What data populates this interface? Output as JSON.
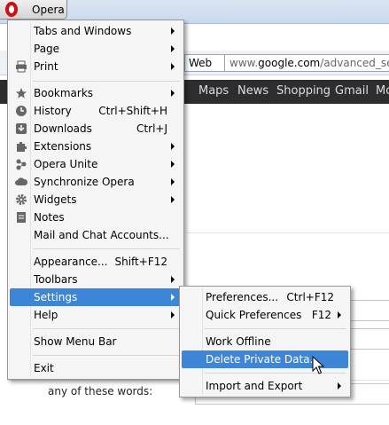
{
  "browser": {
    "opera_button_label": "Opera",
    "search_engine": "Web",
    "url_prefix": "www.",
    "url_domain": "google.com",
    "url_rest": "/advanced_searc",
    "google_nav": [
      "Maps",
      "News",
      "Shopping",
      "Gmail",
      "Mo"
    ],
    "form_label": "any of these words:"
  },
  "main_menu": {
    "items": [
      {
        "label": "Tabs and Windows",
        "shortcut": "",
        "submenu": true
      },
      {
        "label": "Page",
        "shortcut": "",
        "submenu": true
      },
      {
        "label": "Print",
        "shortcut": "",
        "submenu": true,
        "icon": "printer-icon"
      },
      {
        "label": "Bookmarks",
        "shortcut": "",
        "submenu": true,
        "icon": "star-icon"
      },
      {
        "label": "History",
        "shortcut": "Ctrl+Shift+H",
        "submenu": false,
        "icon": "clock-icon"
      },
      {
        "label": "Downloads",
        "shortcut": "Ctrl+J",
        "submenu": false,
        "icon": "download-icon"
      },
      {
        "label": "Extensions",
        "shortcut": "",
        "submenu": true,
        "icon": "puzzle-icon"
      },
      {
        "label": "Opera Unite",
        "shortcut": "",
        "submenu": true,
        "icon": "unite-icon"
      },
      {
        "label": "Synchronize Opera",
        "shortcut": "",
        "submenu": true,
        "icon": "cloud-icon"
      },
      {
        "label": "Widgets",
        "shortcut": "",
        "submenu": true,
        "icon": "gear-icon"
      },
      {
        "label": "Notes",
        "shortcut": "",
        "submenu": false,
        "icon": "notes-icon"
      },
      {
        "label": "Mail and Chat Accounts...",
        "shortcut": "",
        "submenu": false
      },
      {
        "label": "Appearance...",
        "shortcut": "Shift+F12",
        "submenu": false
      },
      {
        "label": "Toolbars",
        "shortcut": "",
        "submenu": true
      },
      {
        "label": "Settings",
        "shortcut": "",
        "submenu": true,
        "highlighted": true
      },
      {
        "label": "Help",
        "shortcut": "",
        "submenu": true
      },
      {
        "label": "Show Menu Bar",
        "shortcut": "",
        "submenu": false
      },
      {
        "label": "Exit",
        "shortcut": "",
        "submenu": false
      }
    ]
  },
  "settings_menu": {
    "items": [
      {
        "label": "Preferences...",
        "shortcut": "Ctrl+F12",
        "submenu": false
      },
      {
        "label": "Quick Preferences",
        "shortcut": "F12",
        "submenu": true
      },
      {
        "label": "Work Offline",
        "shortcut": "",
        "submenu": false
      },
      {
        "label": "Delete Private Data...",
        "shortcut": "",
        "submenu": false,
        "highlighted": true
      },
      {
        "label": "Import and Export",
        "shortcut": "",
        "submenu": true
      }
    ]
  },
  "colors": {
    "highlight": "#3d86d7",
    "opera_red": "#cc1010",
    "google_bar": "#2d2d2d"
  }
}
